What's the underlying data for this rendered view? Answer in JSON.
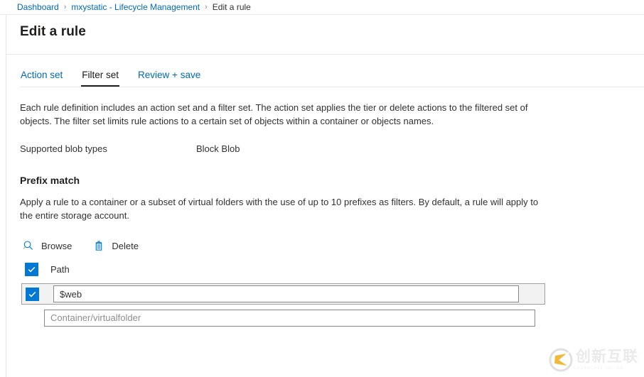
{
  "breadcrumb": {
    "items": [
      {
        "label": "Dashboard",
        "link": true
      },
      {
        "label": "mxystatic - Lifecycle Management",
        "link": true
      },
      {
        "label": "Edit a rule",
        "link": false
      }
    ],
    "separator": "›"
  },
  "blade": {
    "title": "Edit a rule"
  },
  "tabs": [
    {
      "label": "Action set",
      "active": false
    },
    {
      "label": "Filter set",
      "active": true
    },
    {
      "label": "Review + save",
      "active": false
    }
  ],
  "main": {
    "description": "Each rule definition includes an action set and a filter set. The action set applies the tier or delete actions to the filtered set of objects. The filter set limits rule actions to a certain set of objects within a container or objects names.",
    "blob_types": {
      "label": "Supported blob types",
      "value": "Block Blob"
    },
    "prefix_match": {
      "heading": "Prefix match",
      "description": "Apply a rule to a container or a subset of virtual folders with the use of up to 10 prefixes as filters. By default, a rule will apply to the entire storage account.",
      "commands": [
        {
          "label": "Browse",
          "icon": "search-icon"
        },
        {
          "label": "Delete",
          "icon": "trash-icon"
        }
      ],
      "path_header": {
        "label": "Path",
        "checked": true
      },
      "rows": [
        {
          "value": "$web",
          "placeholder": "Container/virtualfolder",
          "checked": true,
          "selected": true
        },
        {
          "value": "",
          "placeholder": "Container/virtualfolder",
          "checked": false,
          "selected": false
        }
      ]
    }
  },
  "watermark": {
    "text": "创新互联",
    "subtext": "CHUANGXIN HULIAN"
  },
  "colors": {
    "link": "#0069b4",
    "accent": "#0078d4",
    "active_tab_underline": "#201f1e",
    "text": "#323130",
    "placeholder": "#8d8d8d",
    "border": "#8a8886",
    "watermark": "#e9e9e9"
  }
}
